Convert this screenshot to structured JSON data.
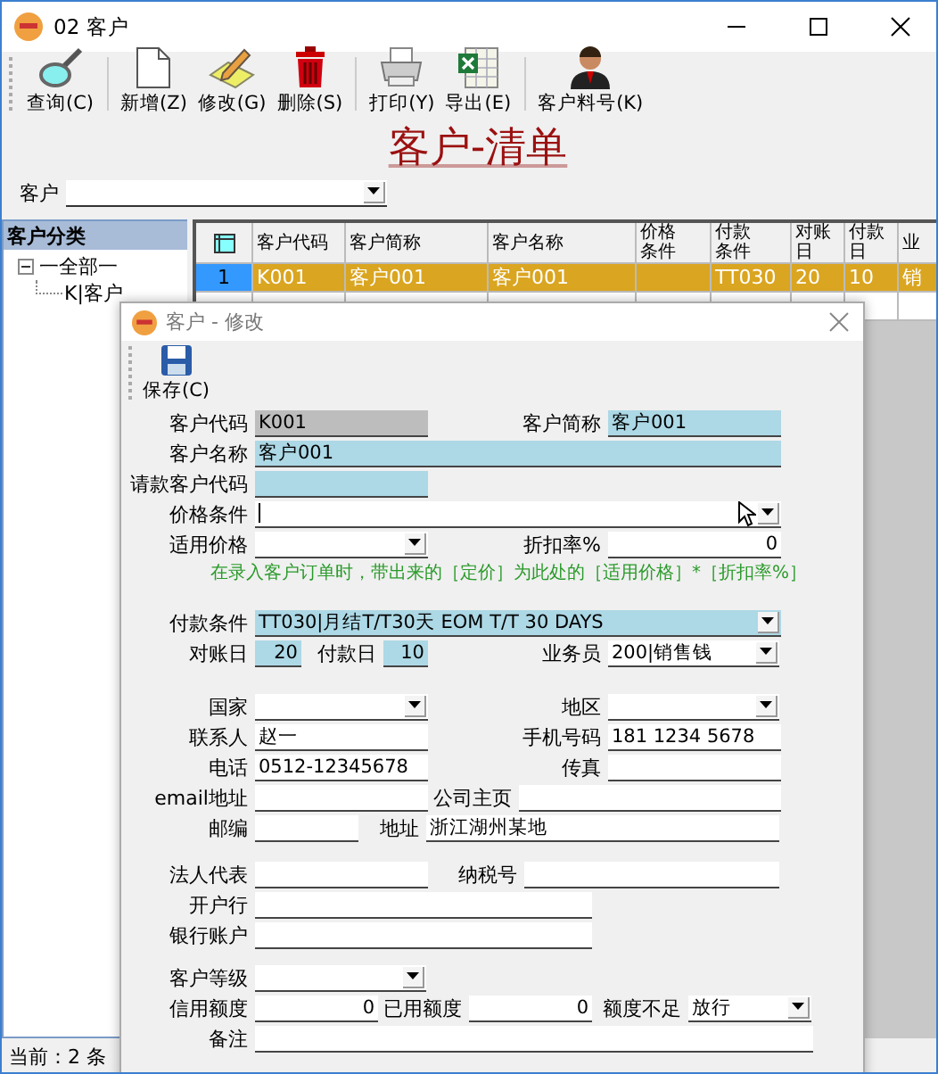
{
  "window": {
    "title": "02 客户"
  },
  "toolbar": [
    {
      "label": "查询(C)",
      "kind": "search",
      "separator_after": true
    },
    {
      "label": "新增(Z)",
      "kind": "page",
      "separator_after": false
    },
    {
      "label": "修改(G)",
      "kind": "edit",
      "separator_after": false
    },
    {
      "label": "删除(S)",
      "kind": "trash",
      "separator_after": true
    },
    {
      "label": "打印(Y)",
      "kind": "printer",
      "separator_after": false
    },
    {
      "label": "导出(E)",
      "kind": "sheet",
      "separator_after": true
    },
    {
      "label": "客户料号(K)",
      "kind": "person",
      "separator_after": false
    }
  ],
  "page_title": "客户-清单",
  "filter": {
    "label": "客户"
  },
  "sidebar": {
    "title": "客户分类",
    "tree": [
      {
        "label": "一全部一",
        "expanded": true,
        "children": [
          {
            "label": "K|客户"
          }
        ]
      }
    ]
  },
  "table": {
    "columns": [
      "客户代码",
      "客户简称",
      "客户名称",
      "价格条件",
      "付款条件",
      "对账日",
      "付款日",
      "业"
    ],
    "rows": [
      {
        "number": "1",
        "selected": true,
        "cells": [
          "K001",
          "客户001",
          "客户001",
          null,
          "TT030",
          "20",
          "10",
          "销"
        ]
      }
    ]
  },
  "status_bar": "当前：2 条",
  "dialog": {
    "title": "客户 - 修改",
    "save": "保存(C)",
    "form": {
      "customer_code": {
        "label": "客户代码",
        "value": "K001",
        "disabled": true
      },
      "short_name": {
        "label": "客户简称",
        "value": "客户001",
        "required": true
      },
      "customer_name": {
        "label": "客户名称",
        "value": "客户001",
        "required": true
      },
      "billing_code": {
        "label": "请款客户代码",
        "required": true
      },
      "price_terms": {
        "label": "价格条件"
      },
      "applicable_price": {
        "label": "适用价格"
      },
      "discount_rate": {
        "label": "折扣率%",
        "value": "0"
      },
      "note": "在录入客户订单时，带出来的［定价］为此处的［适用价格］*［折扣率%］",
      "payment_terms": {
        "label": "付款条件",
        "value": "TT030|月结T/T30天 EOM T/T 30 DAYS",
        "required": true
      },
      "statement_day": {
        "label": "对账日",
        "value": "20",
        "required": true
      },
      "payment_day": {
        "label": "付款日",
        "value": "10",
        "required": true
      },
      "salesperson": {
        "label": "业务员",
        "value": "200|销售钱"
      },
      "country": {
        "label": "国家"
      },
      "region": {
        "label": "地区"
      },
      "contact": {
        "label": "联系人",
        "value": "赵一"
      },
      "mobile": {
        "label": "手机号码",
        "value": "181 1234 5678"
      },
      "phone": {
        "label": "电话",
        "value": "0512-12345678"
      },
      "fax": {
        "label": "传真"
      },
      "email": {
        "label": "email地址"
      },
      "homepage": {
        "label": "公司主页"
      },
      "postcode": {
        "label": "邮编"
      },
      "address": {
        "label": "地址",
        "value": "浙江湖州某地"
      },
      "legal_rep": {
        "label": "法人代表"
      },
      "tax_no": {
        "label": "纳税号"
      },
      "bank": {
        "label": "开户行"
      },
      "bank_account": {
        "label": "银行账户"
      },
      "grade": {
        "label": "客户等级"
      },
      "credit_limit": {
        "label": "信用额度",
        "value": "0"
      },
      "used_credit": {
        "label": "已用额度",
        "value": "0"
      },
      "over_limit": {
        "label": "额度不足",
        "value": "放行"
      },
      "remarks": {
        "label": "备注"
      }
    }
  }
}
